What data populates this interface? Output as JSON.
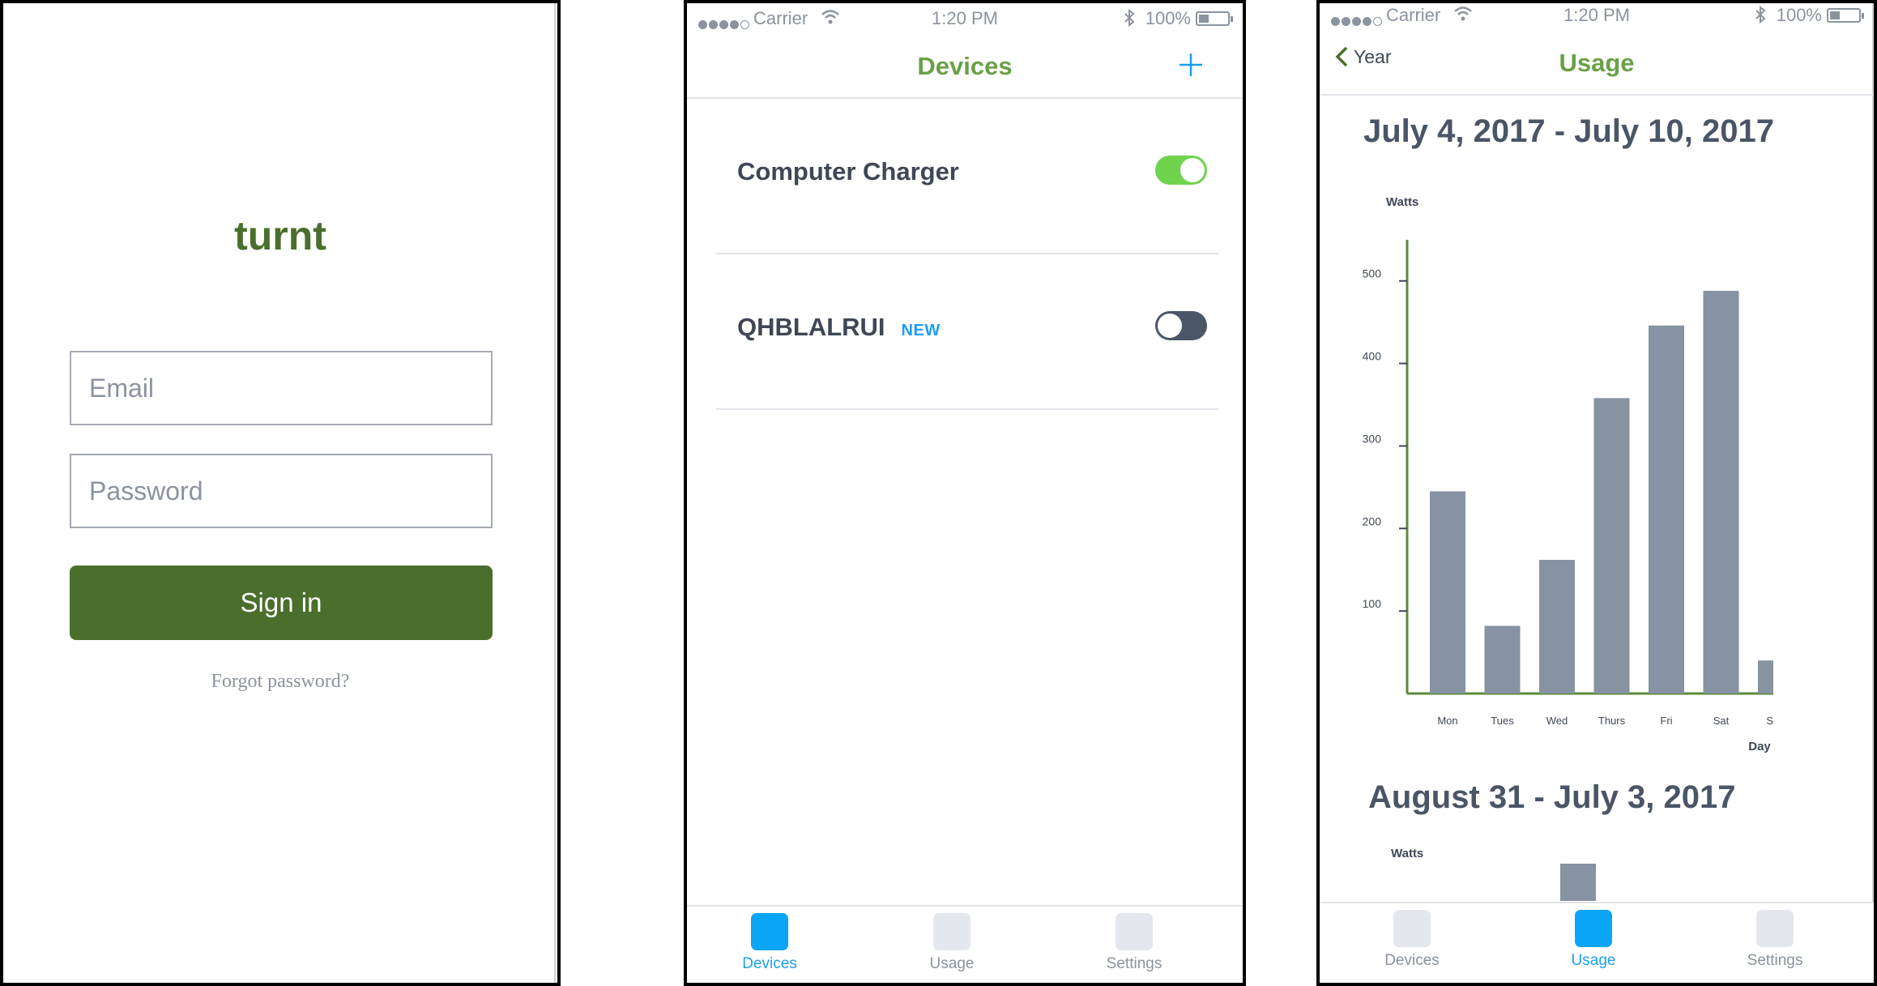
{
  "login": {
    "brand": "turnt",
    "email_placeholder": "Email",
    "password_placeholder": "Password",
    "signin_label": "Sign in",
    "forgot_label": "Forgot password?",
    "brand_color": "#4a6f2c"
  },
  "status": {
    "carrier": "Carrier",
    "time": "1:20 PM",
    "battery": "100%"
  },
  "devices": {
    "title": "Devices",
    "add_icon": "plus-icon",
    "items": [
      {
        "name": "Computer Charger",
        "badge": "",
        "on": true
      },
      {
        "name": "QHBLALRUI",
        "badge": "NEW",
        "on": false
      }
    ]
  },
  "usage": {
    "title": "Usage",
    "back_label": "Year",
    "range1": "July 4, 2017 - July 10, 2017",
    "range2": "August 31 - July 3, 2017"
  },
  "tabs": [
    "Devices",
    "Usage",
    "Settings"
  ],
  "colors": {
    "accent": "#1a9ff0",
    "green": "#6aa047",
    "bar": "#8792a2"
  },
  "chart_data": [
    {
      "type": "bar",
      "ylabel": "Watts",
      "xlabel": "Day",
      "categories": [
        "Mon",
        "Tues",
        "Wed",
        "Thurs",
        "Fri",
        "Sat",
        "Sun"
      ],
      "values": [
        245,
        82,
        162,
        358,
        446,
        488,
        40
      ],
      "yticks": [
        100,
        200,
        300,
        400,
        500
      ],
      "ylim": [
        0,
        540
      ],
      "grid": false
    },
    {
      "type": "bar",
      "ylabel": "Watts",
      "partial": true
    }
  ]
}
